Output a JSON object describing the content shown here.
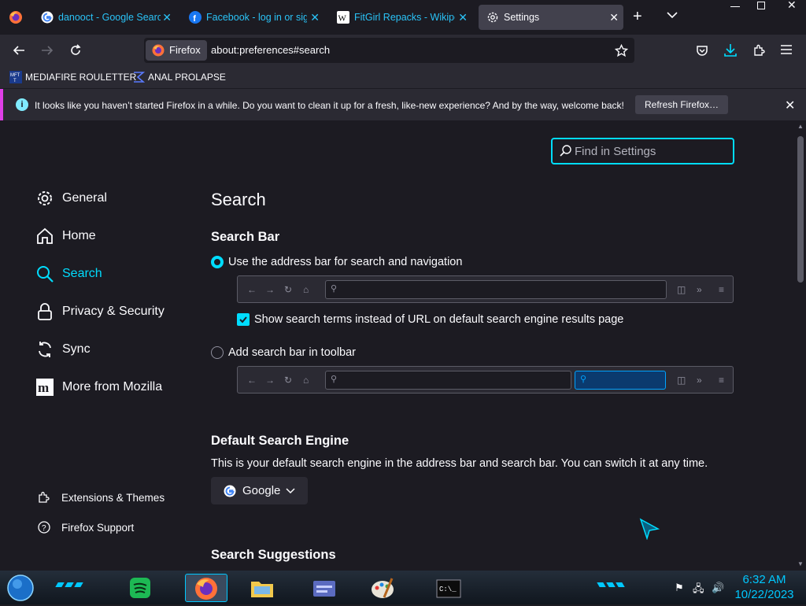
{
  "tabs": [
    {
      "title": "danooct - Google Search",
      "icon": "google-icon"
    },
    {
      "title": "Facebook - log in or sign up",
      "icon": "facebook-icon"
    },
    {
      "title": "FitGirl Repacks - Wikipedia",
      "icon": "wikipedia-icon"
    },
    {
      "title": "Settings",
      "icon": "gear-icon",
      "active": true
    }
  ],
  "urlbar": {
    "identity": "Firefox",
    "url": "about:preferences#search"
  },
  "bookmarks": [
    {
      "label": "MEDIAFIRE ROULETTER",
      "icon": "mft-icon"
    },
    {
      "label": "ANAL PROLAPSE",
      "icon": "sigma-icon"
    }
  ],
  "notification": {
    "message": "It looks like you haven’t started Firefox in a while. Do you want to clean it up for a fresh, like-new experience? And by the way, welcome back!",
    "button": "Refresh Firefox…"
  },
  "find": {
    "placeholder": "Find in Settings"
  },
  "sidebar": {
    "categories": [
      {
        "label": "General",
        "icon": "gear-icon"
      },
      {
        "label": "Home",
        "icon": "home-icon"
      },
      {
        "label": "Search",
        "icon": "search-icon",
        "selected": true
      },
      {
        "label": "Privacy & Security",
        "icon": "lock-icon"
      },
      {
        "label": "Sync",
        "icon": "sync-icon"
      },
      {
        "label": "More from Mozilla",
        "icon": "mozilla-icon"
      }
    ],
    "footer": [
      {
        "label": "Extensions & Themes",
        "icon": "puzzle-icon"
      },
      {
        "label": "Firefox Support",
        "icon": "help-icon"
      }
    ]
  },
  "main": {
    "title": "Search",
    "search_bar": {
      "heading": "Search Bar",
      "option_address": "Use the address bar for search and navigation",
      "option_address_selected": true,
      "show_terms": "Show search terms instead of URL on default search engine results page",
      "show_terms_checked": true,
      "option_toolbar": "Add search bar in toolbar",
      "option_toolbar_selected": false
    },
    "default_engine": {
      "heading": "Default Search Engine",
      "description": "This is your default search engine in the address bar and search bar. You can switch it at any time.",
      "selected": "Google"
    },
    "suggestions": {
      "heading": "Search Suggestions"
    }
  },
  "taskbar": {
    "time": "6:32 AM",
    "date": "10/22/2023"
  },
  "colors": {
    "accent": "#00ddff",
    "tab_link": "#2ac3f7",
    "bg": "#1c1b22",
    "panel": "#2b2a33",
    "notify_border": "#e03fe8"
  }
}
